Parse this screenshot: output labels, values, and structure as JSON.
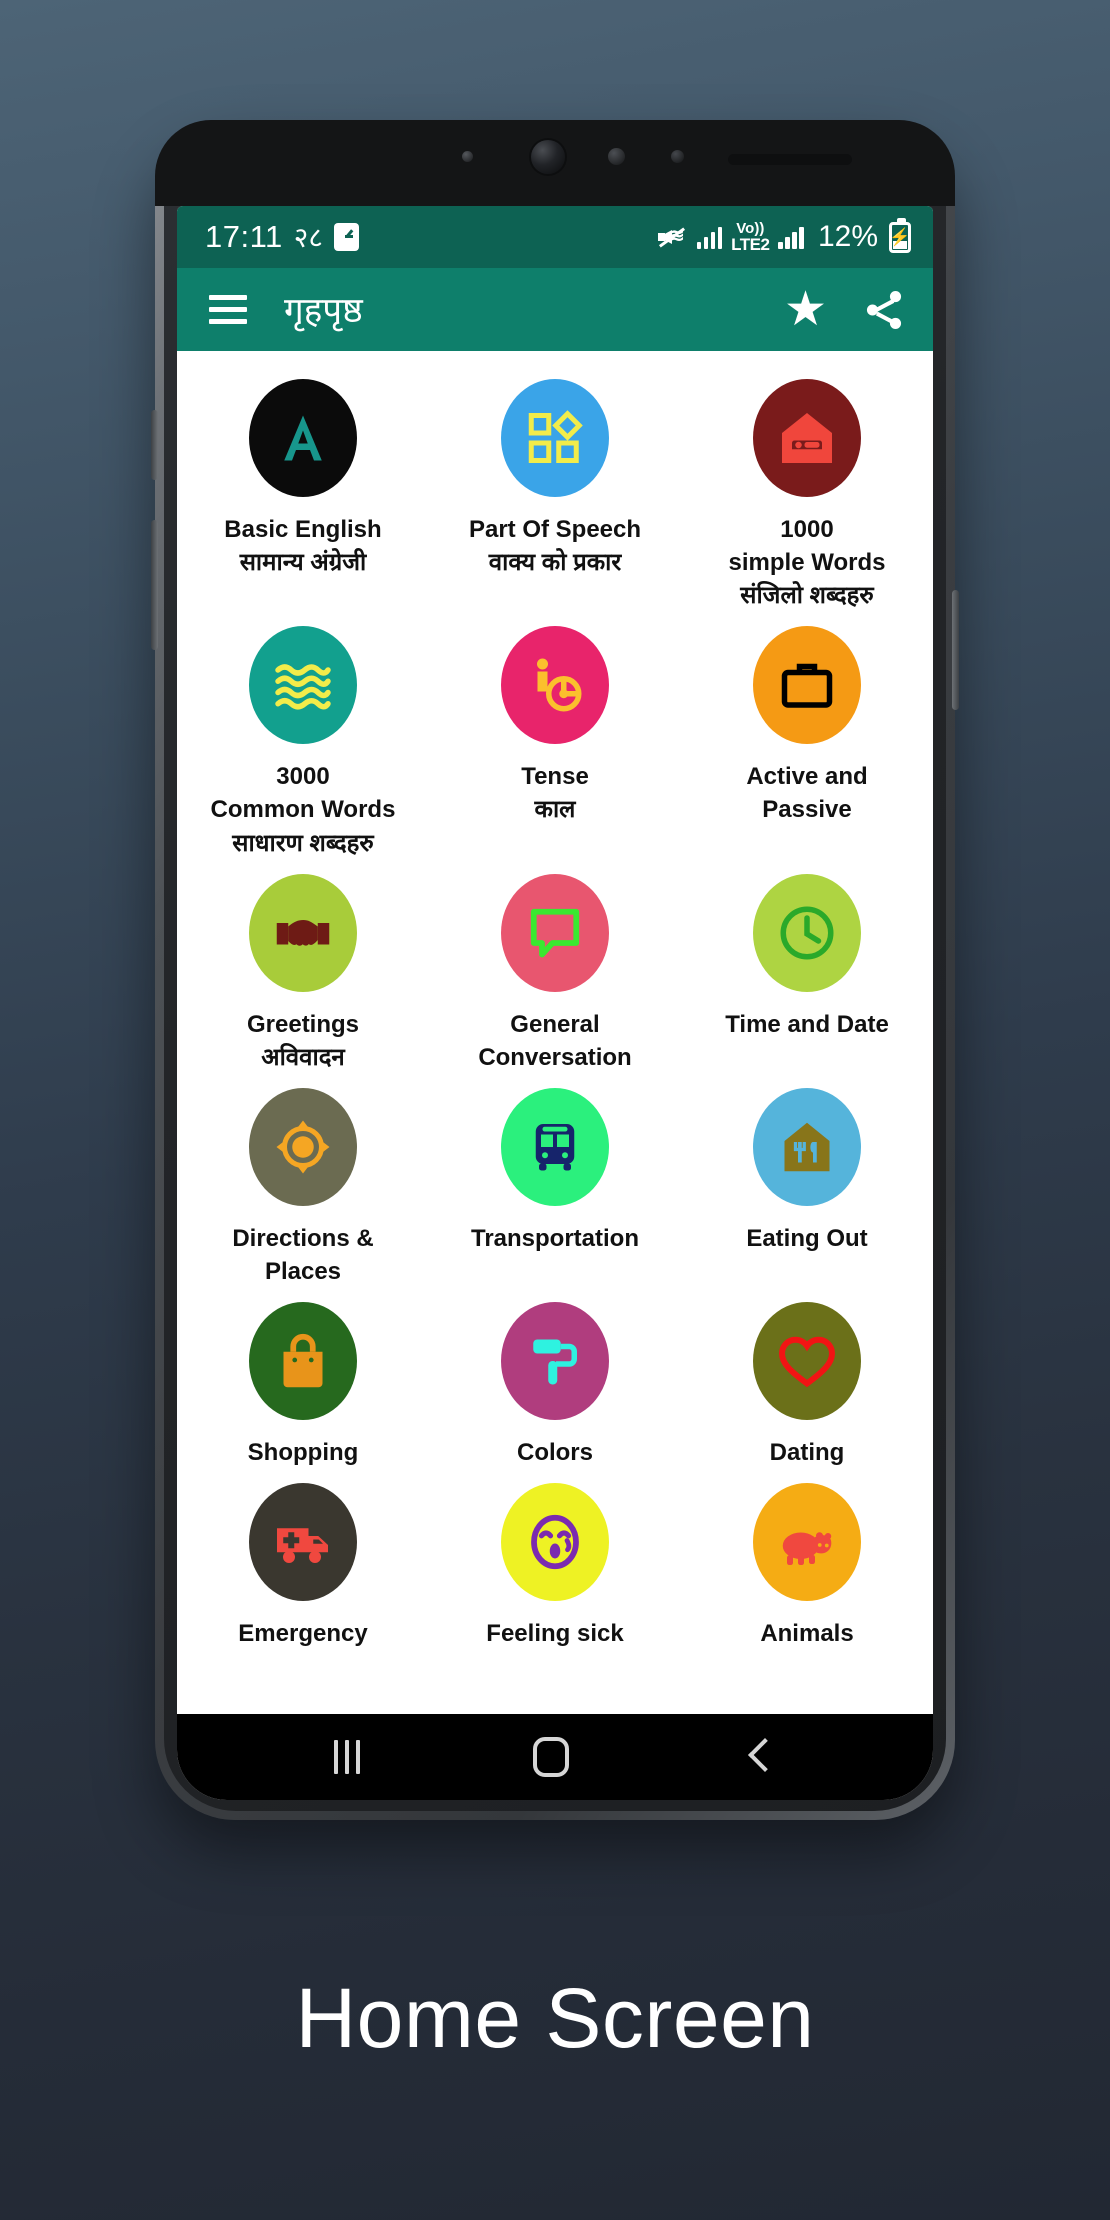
{
  "caption": "Home Screen",
  "status_bar": {
    "time": "17:11",
    "devanagari_digits": "२८",
    "alarm_icon": "alarm-clock-icon",
    "mute_icon": "volume-mute-icon",
    "signal_icon_1": "signal-bars-icon",
    "volte_line1": "Vo))",
    "volte_line2": "LTE2",
    "signal_icon_2": "signal-bars-icon",
    "battery_percent": "12%",
    "battery_icon": "battery-charging-icon",
    "background": "#0d6253"
  },
  "app_bar": {
    "menu_icon": "hamburger-menu-icon",
    "title": "गृहपृष्ठ",
    "favorite_icon": "★",
    "share_icon": "share-icon",
    "background": "#0e7f6b"
  },
  "grid": {
    "items": [
      {
        "line1": "Basic English",
        "line2": "सामान्य अंग्रेजी",
        "bubble": "#0b0b0b",
        "icon": "letter-a-icon",
        "icon_color": "#17968c"
      },
      {
        "line1": "Part Of Speech",
        "line2": "वाक्य को प्रकार",
        "bubble": "#3aa4e8",
        "icon": "shapes-icon",
        "icon_color": "#f2ec4a"
      },
      {
        "line1": "1000",
        "line2": "simple Words",
        "line3": "संजिलो शब्दहरु",
        "bubble": "#7a1b1b",
        "icon": "bed-house-icon",
        "icon_color": "#f0463c"
      },
      {
        "line1": "3000",
        "line2": "Common Words",
        "line3": "साधारण शब्दहरु",
        "bubble": "#12a08e",
        "icon": "waves-icon",
        "icon_color": "#f2ec4a"
      },
      {
        "line1": "Tense",
        "line2": "काल",
        "bubble": "#e8246b",
        "icon": "accessibility-icon",
        "icon_color": "#fbc02d"
      },
      {
        "line1": "Active and",
        "line2": "Passive",
        "bubble": "#f59a14",
        "icon": "briefcase-icon",
        "icon_color": "#000000"
      },
      {
        "line1": "Greetings",
        "line2": "अविवादन",
        "bubble": "#a8cc3a",
        "icon": "handshake-icon",
        "icon_color": "#6e1b15"
      },
      {
        "line1": "General",
        "line2": "Conversation",
        "bubble": "#e8566f",
        "icon": "chat-bubble-icon",
        "icon_color": "#3ae830"
      },
      {
        "line1": "Time and Date",
        "bubble": "#aed442",
        "icon": "clock-icon",
        "icon_color": "#2aa92a"
      },
      {
        "line1": "Directions &",
        "line2": "Places",
        "bubble": "#6b6b51",
        "icon": "target-crosshair-icon",
        "icon_color": "#f5a623"
      },
      {
        "line1": "Transportation",
        "bubble": "#2bf07d",
        "icon": "bus-icon",
        "icon_color": "#16246b"
      },
      {
        "line1": "Eating Out",
        "bubble": "#55b4db",
        "icon": "restaurant-house-icon",
        "icon_color": "#88751a"
      },
      {
        "line1": "Shopping",
        "bubble": "#26691e",
        "icon": "shopping-bag-icon",
        "icon_color": "#e8941a"
      },
      {
        "line1": "Colors",
        "bubble": "#b03d7e",
        "icon": "paint-roller-icon",
        "icon_color": "#2ef2e0"
      },
      {
        "line1": "Dating",
        "bubble": "#6b7019",
        "icon": "heart-icon",
        "icon_color": "#f21414"
      },
      {
        "line1": "Emergency",
        "bubble": "#3a372f",
        "icon": "ambulance-icon",
        "icon_color": "#f0483f"
      },
      {
        "line1": "Feeling sick",
        "bubble": "#eef224",
        "icon": "crying-face-icon",
        "icon_color": "#7b2ab0"
      },
      {
        "line1": "Animals",
        "bubble": "#f5ac14",
        "icon": "hippo-icon",
        "icon_color": "#f0483f"
      }
    ]
  },
  "nav_bar": {
    "recents_icon": "recents-icon",
    "home_icon": "home-icon",
    "back_icon": "back-icon"
  }
}
